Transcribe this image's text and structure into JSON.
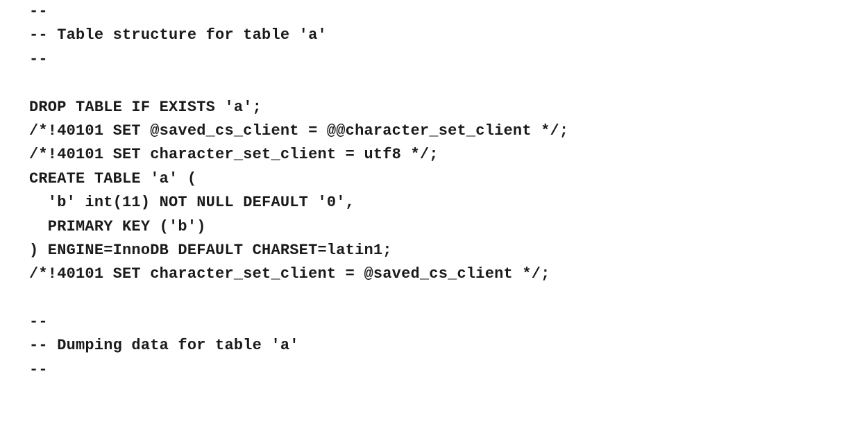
{
  "document": {
    "lines": [
      "--",
      "-- Table structure for table 'a'",
      "--",
      "",
      "DROP TABLE IF EXISTS 'a';",
      "/*!40101 SET @saved_cs_client = @@character_set_client */;",
      "/*!40101 SET character_set_client = utf8 */;",
      "CREATE TABLE 'a' (",
      "  'b' int(11) NOT NULL DEFAULT '0',",
      "  PRIMARY KEY ('b')",
      ") ENGINE=InnoDB DEFAULT CHARSET=latin1;",
      "/*!40101 SET character_set_client = @saved_cs_client */;",
      "",
      "--",
      "-- Dumping data for table 'a'",
      "--"
    ]
  }
}
